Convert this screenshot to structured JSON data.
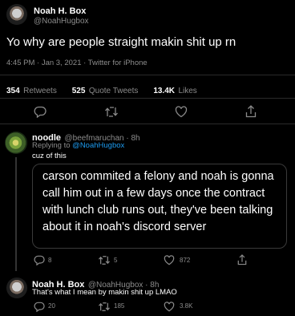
{
  "main_tweet": {
    "name": "Noah H. Box",
    "handle": "@NoahHugbox",
    "text": "Yo why are people straight makin shit up rn",
    "meta": "4:45 PM · Jan 3, 2021 · Twitter for iPhone",
    "stats": {
      "retweets_num": "354",
      "retweets_label": "Retweets",
      "quotes_num": "525",
      "quotes_label": "Quote Tweets",
      "likes_num": "13.4K",
      "likes_label": "Likes"
    }
  },
  "reply1": {
    "name": "noodle",
    "handle": "@beefmaruchan · 8h",
    "replying_prefix": "Replying to ",
    "replying_handle": "@NoahHugbox",
    "text": "cuz of this",
    "quote_text": "carson commited a felony and noah is gonna call him out in a few days once the contract with lunch club runs out, they've been talking about it in noah's discord server",
    "reply_count": "8",
    "retweet_count": "5",
    "like_count": "872"
  },
  "reply2": {
    "name": "Noah H. Box",
    "handle": "@NoahHugbox · 8h",
    "text": "That's what I mean by makin shit up LMAO",
    "reply_count": "20",
    "retweet_count": "185",
    "like_count": "3.8K"
  },
  "colors": {
    "background": "#000000",
    "link": "#1d9bf0",
    "muted": "#8b8b8b"
  },
  "icons": [
    "reply-icon",
    "retweet-icon",
    "like-icon",
    "share-icon"
  ]
}
